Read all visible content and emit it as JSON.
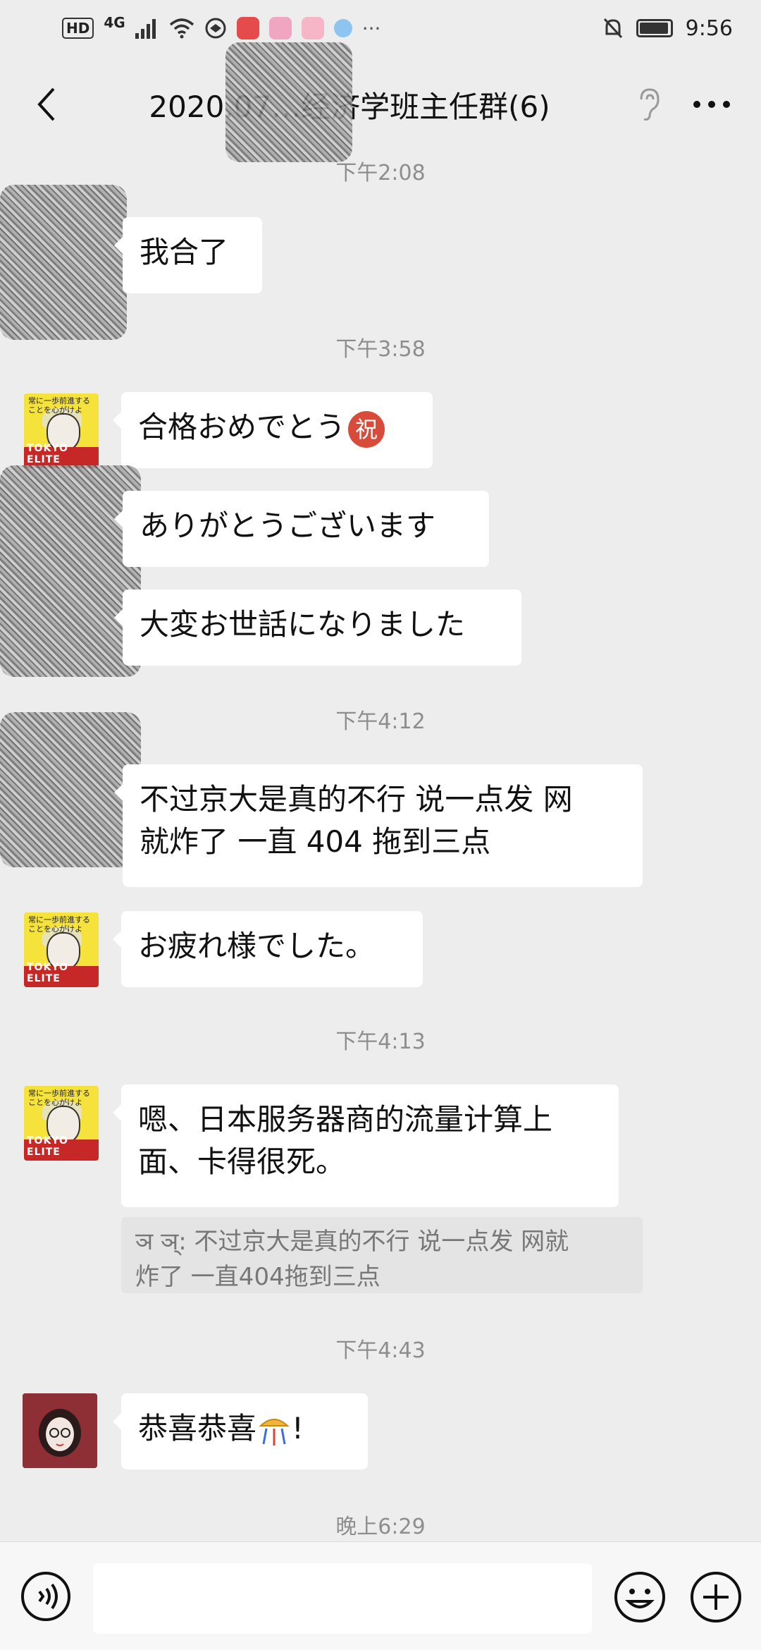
{
  "status_bar": {
    "hd": "HD",
    "network": "4G",
    "time": "9:56",
    "app_icon_colors": [
      "#e54b4b",
      "#f0a5c0",
      "#f6b6c8",
      "#8ec5f0"
    ]
  },
  "nav": {
    "title": "2020.07…经济学班主任群(6)",
    "back_icon": "chevron-left-icon",
    "ear_icon": "ear-icon",
    "more_icon": "more-dots-icon"
  },
  "messages": {
    "t1": "下午2:08",
    "m1": "我合了",
    "t2": "下午3:58",
    "m2": "合格おめでとう",
    "m2_badge": "祝",
    "m3": "ありがとうございます",
    "m4": "大変お世話になりました",
    "t3": "下午4:12",
    "m5_line1": "不过京大是真的不行 说一点发 网",
    "m5_line2": "就炸了 一直 404 拖到三点",
    "m6": "お疲れ様でした。",
    "t4": "下午4:13",
    "m7_line1": "嗯、日本服务器商的流量计算上",
    "m7_line2": "面、卡得很死。",
    "quote_line1": "ञ ञ्: 不过京大是真的不行 说一点发 网就",
    "quote_line2": "炸了 一直404拖到三点",
    "t5": "下午4:43",
    "m8": "恭喜恭喜",
    "m8_suffix": "!",
    "t6": "晚上6:29"
  },
  "avatar": {
    "tokyo_text": "常に一歩前進する\nことを心がけよ",
    "tokyo_label": "TOKYO ELITE"
  },
  "input_bar": {
    "placeholder": "",
    "voice_icon": "voice-icon",
    "emoji_icon": "emoji-icon",
    "plus_icon": "plus-icon"
  },
  "colors": {
    "background": "#ededed",
    "bubble": "#ffffff",
    "timestamp": "#8e8e8e",
    "badge_red": "#d84a3a"
  }
}
